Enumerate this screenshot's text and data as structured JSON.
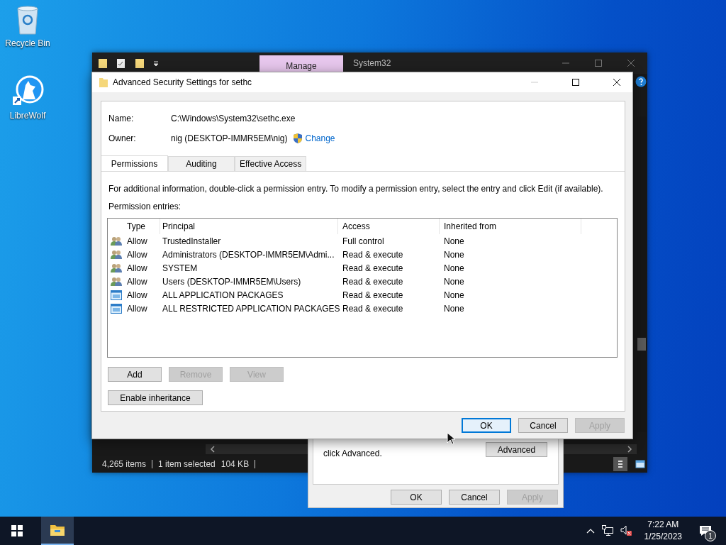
{
  "desktop_icons": [
    {
      "kind": "recycle",
      "label": "Recycle Bin"
    },
    {
      "kind": "browser",
      "label": "LibreWolf"
    }
  ],
  "explorer": {
    "ribbon_tab": "Manage",
    "title": "System32",
    "status": [
      "4,265 items",
      "1 item selected",
      "104 KB"
    ]
  },
  "properties_dialog": {
    "note": "click Advanced.",
    "advanced_button": "Advanced",
    "buttons": [
      {
        "label": "OK",
        "disabled": false
      },
      {
        "label": "Cancel",
        "disabled": false
      },
      {
        "label": "Apply",
        "disabled": true
      }
    ]
  },
  "dialog": {
    "title": "Advanced Security Settings for sethc",
    "name_label": "Name:",
    "name_value": "C:\\Windows\\System32\\sethc.exe",
    "owner_label": "Owner:",
    "owner_value": "nig (DESKTOP-IMMR5EM\\nig)",
    "change_link": "Change",
    "tabs": [
      {
        "label": "Permissions",
        "selected": true
      },
      {
        "label": "Auditing",
        "selected": false
      },
      {
        "label": "Effective Access",
        "selected": false
      }
    ],
    "info": "For additional information, double-click a permission entry. To modify a permission entry, select the entry and click Edit (if available).",
    "entries_label": "Permission entries:",
    "columns": [
      "Type",
      "Principal",
      "Access",
      "Inherited from"
    ],
    "rows": [
      {
        "kind": "group",
        "type": "Allow",
        "principal": "TrustedInstaller",
        "access": "Full control",
        "inherited": "None"
      },
      {
        "kind": "group",
        "type": "Allow",
        "principal": "Administrators (DESKTOP-IMMR5EM\\Admi...",
        "access": "Read & execute",
        "inherited": "None"
      },
      {
        "kind": "group",
        "type": "Allow",
        "principal": "SYSTEM",
        "access": "Read & execute",
        "inherited": "None"
      },
      {
        "kind": "group",
        "type": "Allow",
        "principal": "Users (DESKTOP-IMMR5EM\\Users)",
        "access": "Read & execute",
        "inherited": "None"
      },
      {
        "kind": "package",
        "type": "Allow",
        "principal": "ALL APPLICATION PACKAGES",
        "access": "Read & execute",
        "inherited": "None"
      },
      {
        "kind": "package",
        "type": "Allow",
        "principal": "ALL RESTRICTED APPLICATION PACKAGES",
        "access": "Read & execute",
        "inherited": "None"
      }
    ],
    "actions": [
      {
        "label": "Add",
        "disabled": false
      },
      {
        "label": "Remove",
        "disabled": true
      },
      {
        "label": "View",
        "disabled": true
      }
    ],
    "inheritance_button": "Enable inheritance",
    "buttons": [
      {
        "label": "OK",
        "disabled": false,
        "focused": true
      },
      {
        "label": "Cancel",
        "disabled": false,
        "focused": false
      },
      {
        "label": "Apply",
        "disabled": true,
        "focused": false
      }
    ]
  },
  "taskbar": {
    "time": "7:22 AM",
    "date": "1/25/2023",
    "notification_count": "1"
  }
}
